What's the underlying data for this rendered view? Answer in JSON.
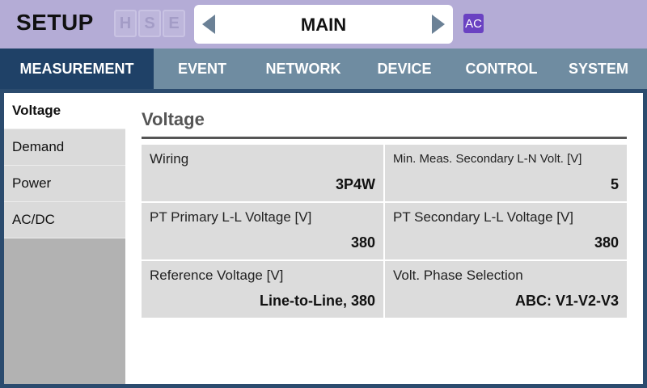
{
  "header": {
    "title": "SETUP",
    "indicators": [
      "H",
      "S",
      "E"
    ],
    "mode": "MAIN",
    "badge": "AC"
  },
  "tabs": [
    {
      "label": "MEASUREMENT",
      "active": true
    },
    {
      "label": "EVENT",
      "active": false
    },
    {
      "label": "NETWORK",
      "active": false
    },
    {
      "label": "DEVICE",
      "active": false
    },
    {
      "label": "CONTROL",
      "active": false
    },
    {
      "label": "SYSTEM",
      "active": false
    }
  ],
  "sidebar": {
    "items": [
      {
        "label": "Voltage",
        "active": true
      },
      {
        "label": "Demand",
        "active": false
      },
      {
        "label": "Power",
        "active": false
      },
      {
        "label": "AC/DC",
        "active": false
      }
    ]
  },
  "content": {
    "title": "Voltage",
    "fields": [
      {
        "label": "Wiring",
        "value": "3P4W"
      },
      {
        "label": "Min. Meas. Secondary L-N Volt. [V]",
        "value": "5"
      },
      {
        "label": "PT Primary L-L Voltage [V]",
        "value": "380"
      },
      {
        "label": "PT Secondary L-L Voltage [V]",
        "value": "380"
      },
      {
        "label": "Reference Voltage [V]",
        "value": "Line-to-Line, 380"
      },
      {
        "label": "Volt. Phase Selection",
        "value": "ABC: V1-V2-V3"
      }
    ]
  },
  "colors": {
    "header_bg": "#b4acd6",
    "tab_bar": "#6f8ca1",
    "tab_active": "#1f4167",
    "frame": "#2b4b6e",
    "badge": "#6a42c2"
  }
}
